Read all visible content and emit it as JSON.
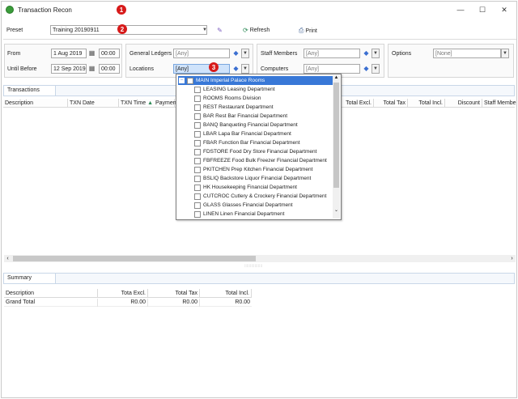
{
  "window": {
    "title": "Transaction Recon",
    "controls": {
      "minimize": "—",
      "maximize": "☐",
      "close": "✕"
    }
  },
  "badges": [
    "1",
    "2",
    "3"
  ],
  "preset": {
    "label": "Preset",
    "value": "Training 20190911",
    "refresh_label": "Refresh",
    "print_label": "Print"
  },
  "filters": {
    "from_label": "From",
    "from_date": "1 Aug 2019",
    "from_time": "00:00",
    "until_label": "Until Before",
    "until_date": "12 Sep 2019",
    "until_time": "00:00",
    "general_ledgers_label": "General Ledgers",
    "general_ledgers_value": "[Any]",
    "locations_label": "Locations",
    "locations_value": "[Any]",
    "staff_members_label": "Staff Members",
    "staff_members_value": "[Any]",
    "computers_label": "Computers",
    "computers_value": "[Any]",
    "options_label": "Options",
    "options_value": "[None]"
  },
  "transactions": {
    "tab_label": "Transactions",
    "columns_left": [
      "Description",
      "TXN Date",
      "TXN Time",
      "Paymen"
    ],
    "columns_right": [
      "Total Excl.",
      "Total Tax",
      "Total Incl.",
      "Discount",
      "Staff Membe"
    ]
  },
  "locations_dropdown": {
    "root_label": "MAIN Imperial Palace Rooms",
    "items": [
      "LEASING Leasing Department",
      "ROOMS Rooms Division",
      "REST Restaurant Department",
      "BAR Rest Bar Financial Department",
      "BANQ Banqueting Financial Department",
      "LBAR Lapa Bar Financial Department",
      "FBAR Function Bar Financial Department",
      "FDSTORE Food Dry Store Financial Department",
      "FBFREEZE Food Bulk Freezer Financial Department",
      "PKITCHEN Prep Kitchen Financial Department",
      "BSLIQ Backstore Liquor Financial Department",
      "HK Housekeeping Financial Department",
      "CUTCROC Cutlery & Crockery Financial Department",
      "GLASS Glasses Financial Department",
      "LINEN Linen Financial Department"
    ]
  },
  "summary": {
    "tab_label": "Summary",
    "columns": [
      "Description",
      "Tota Excl.",
      "Total Tax",
      "Total Incl."
    ],
    "rows": [
      {
        "description": "Grand Total",
        "total_excl": "R0.00",
        "total_tax": "R0.00",
        "total_incl": "R0.00"
      }
    ]
  },
  "splitter_label": "::::::::::::::::"
}
